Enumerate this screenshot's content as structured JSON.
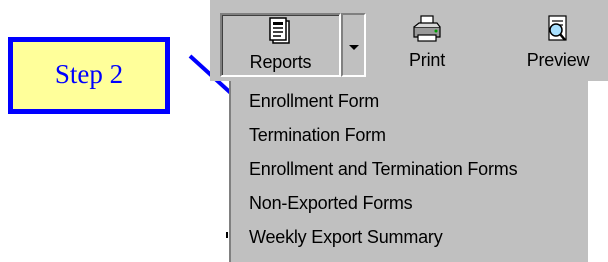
{
  "callout": {
    "text": "Step 2"
  },
  "toolbar": {
    "reports_label": "Reports",
    "print_label": "Print",
    "preview_label": "Preview",
    "icons": {
      "reports": "reports-document-icon",
      "print": "printer-icon",
      "preview": "preview-magnifier-icon",
      "dropdown": "chevron-down-icon"
    }
  },
  "menu": {
    "items": [
      "Enrollment Form",
      "Termination Form",
      "Enrollment and Termination Forms",
      "Non-Exported Forms",
      "Weekly Export Summary"
    ]
  },
  "colors": {
    "callout_fill": "#ffff9a",
    "callout_border": "#0000ff",
    "chrome": "#c0c0c0"
  }
}
